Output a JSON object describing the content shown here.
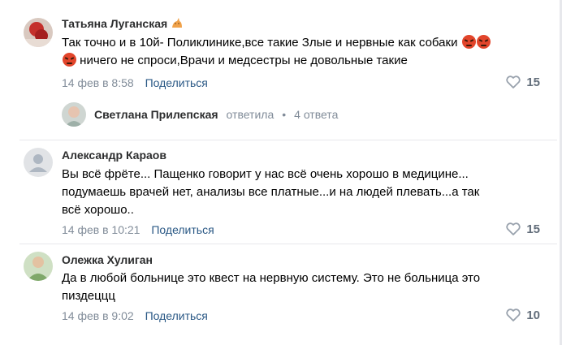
{
  "comments": [
    {
      "author": "Татьяна Луганская",
      "author_badge_icon": "cat-emoji-icon",
      "text_line1": "Так точно и в 10й- Поликлинике,все такие Злые и нервные как собаки",
      "text_line2": "ничего не спроси,Врачи и медсестры не довольные такие",
      "date": "14 фев в 8:58",
      "share_label": "Поделиться",
      "likes": "15",
      "reply": {
        "name": "Светлана Прилепская",
        "replied_label": "ответила",
        "separator": "•",
        "count_label": "4 ответа"
      }
    },
    {
      "author": "Александр Караов",
      "text_line1": "Вы всё фрёте... Пащенко говорит у нас всё очень хорошо в медицине...",
      "text_line2": "подумаешь врачей нет, анализы все платные...и на людей плевать...а так",
      "text_line3": "всё хорошо..",
      "date": "14 фев в 10:21",
      "share_label": "Поделиться",
      "likes": "15"
    },
    {
      "author": "Олежка Хулиган",
      "text_line1": "Да в любой больнице это квест на нервную систему. Это не больница это",
      "text_line2": "пиздеццц",
      "date": "14 фев в 9:02",
      "share_label": "Поделиться",
      "likes": "10"
    }
  ],
  "colors": {
    "link": "#2a5885",
    "meta": "#818c99",
    "divider": "#e7e8ec",
    "angry_emoji": "#e2452b"
  }
}
